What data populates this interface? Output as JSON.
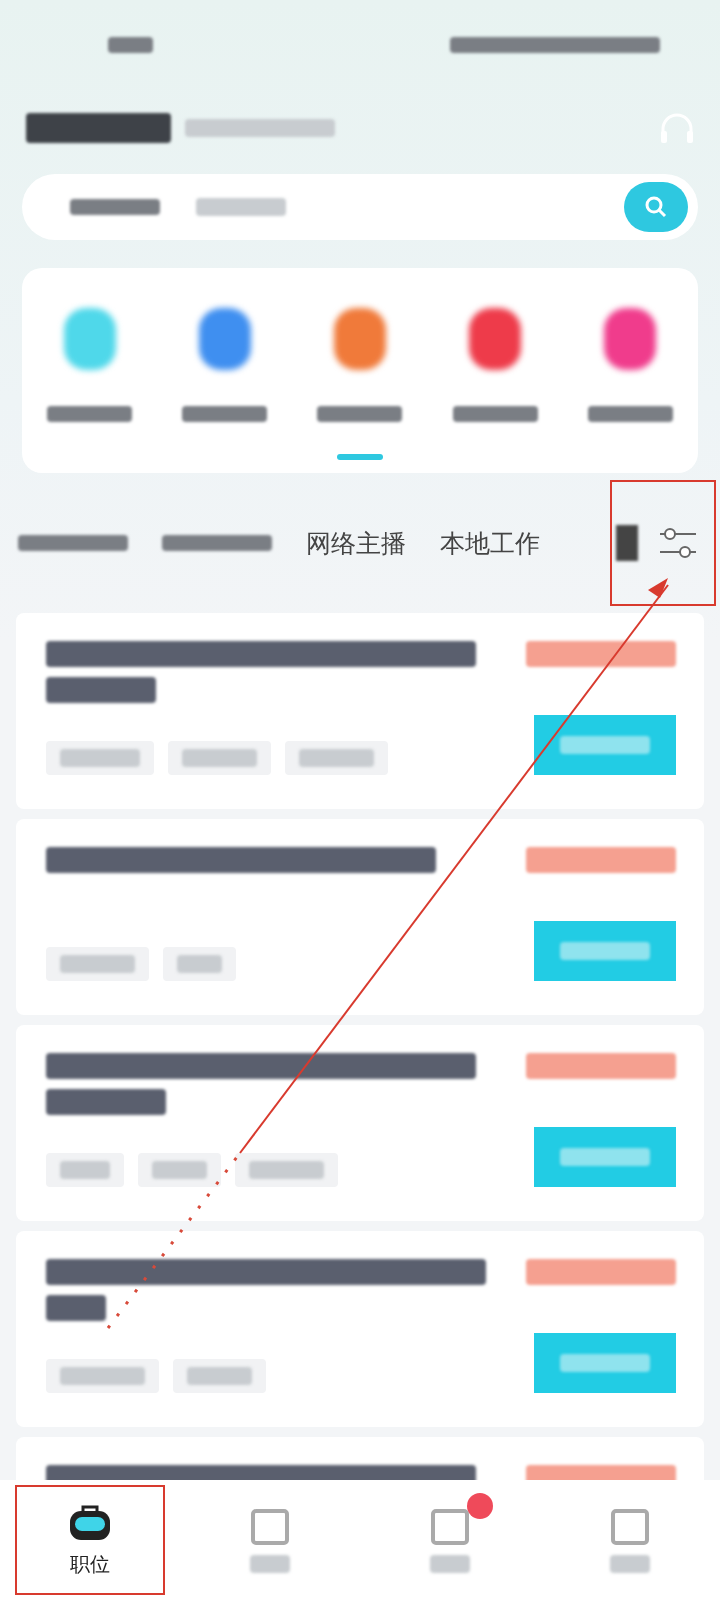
{
  "status_bar": {
    "kind": "blurred"
  },
  "header": {
    "kind": "blurred"
  },
  "search": {
    "kind": "blurred"
  },
  "categories": [
    {
      "color": "#4fd8ea"
    },
    {
      "color": "#3f8ff0"
    },
    {
      "color": "#f07a3a"
    },
    {
      "color": "#ee3b4a"
    },
    {
      "color": "#f03c8c"
    }
  ],
  "tabs": [
    {
      "kind": "blurred"
    },
    {
      "kind": "blurred"
    },
    {
      "kind": "text",
      "label": "网络主播"
    },
    {
      "kind": "text",
      "label": "本地工作"
    }
  ],
  "filter_annotated": true,
  "jobs": [
    {
      "title_lines": [
        {
          "kind": "blurred"
        },
        {
          "kind": "blurred"
        }
      ],
      "tags": [
        {
          "kind": "blurred"
        },
        {
          "kind": "blurred"
        },
        {
          "kind": "blurred"
        }
      ]
    },
    {
      "title_lines": [
        {
          "kind": "blurred"
        }
      ],
      "tags": [
        {
          "kind": "blurred"
        },
        {
          "kind": "blurred"
        }
      ]
    },
    {
      "title_lines": [
        {
          "kind": "blurred"
        },
        {
          "kind": "blurred"
        }
      ],
      "tags": [
        {
          "kind": "blurred"
        },
        {
          "kind": "blurred"
        },
        {
          "kind": "blurred"
        }
      ]
    },
    {
      "title_lines": [
        {
          "kind": "blurred"
        },
        {
          "kind": "blurred"
        }
      ],
      "tags": [
        {
          "kind": "blurred"
        },
        {
          "kind": "blurred"
        }
      ]
    },
    {
      "title_lines": [
        {
          "kind": "blurred"
        }
      ]
    }
  ],
  "nav": [
    {
      "kind": "text",
      "label": "职位",
      "selected": true,
      "annotated": true,
      "badge": false
    },
    {
      "kind": "blurred",
      "selected": false,
      "annotated": false,
      "badge": false
    },
    {
      "kind": "blurred",
      "selected": false,
      "annotated": false,
      "badge": true
    },
    {
      "kind": "blurred",
      "selected": false,
      "annotated": false,
      "badge": false
    }
  ],
  "arrow": true
}
